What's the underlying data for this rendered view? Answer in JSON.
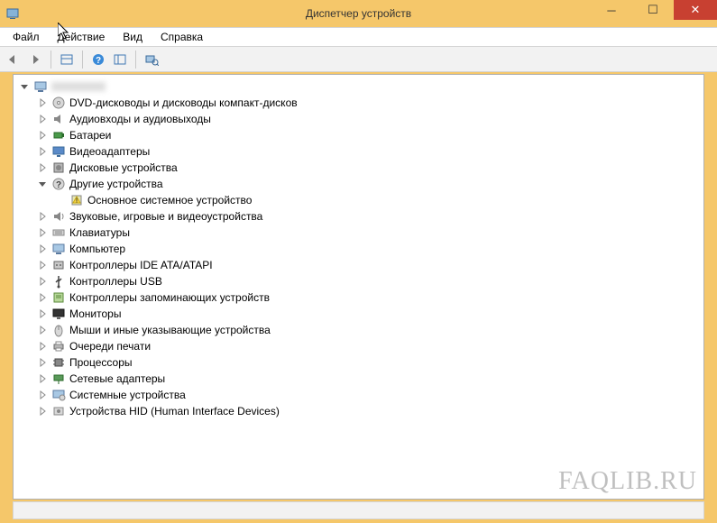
{
  "window": {
    "title": "Диспетчер устройств"
  },
  "menu": {
    "file": "Файл",
    "action": "Действие",
    "view": "Вид",
    "help": "Справка"
  },
  "tree": {
    "root": "",
    "items": [
      {
        "label": "DVD-дисководы и дисководы компакт-дисков",
        "icon": "dvd"
      },
      {
        "label": "Аудиовходы и аудиовыходы",
        "icon": "audio"
      },
      {
        "label": "Батареи",
        "icon": "battery"
      },
      {
        "label": "Видеоадаптеры",
        "icon": "display"
      },
      {
        "label": "Дисковые устройства",
        "icon": "disk"
      },
      {
        "label": "Другие устройства",
        "icon": "other",
        "expanded": true,
        "children": [
          {
            "label": "Основное системное устройство",
            "icon": "warn"
          }
        ]
      },
      {
        "label": "Звуковые, игровые и видеоустройства",
        "icon": "sound"
      },
      {
        "label": "Клавиатуры",
        "icon": "keyboard"
      },
      {
        "label": "Компьютер",
        "icon": "computer"
      },
      {
        "label": "Контроллеры IDE ATA/ATAPI",
        "icon": "ide"
      },
      {
        "label": "Контроллеры USB",
        "icon": "usb"
      },
      {
        "label": "Контроллеры запоминающих устройств",
        "icon": "storage"
      },
      {
        "label": "Мониторы",
        "icon": "monitor"
      },
      {
        "label": "Мыши и иные указывающие устройства",
        "icon": "mouse"
      },
      {
        "label": "Очереди печати",
        "icon": "printer"
      },
      {
        "label": "Процессоры",
        "icon": "cpu"
      },
      {
        "label": "Сетевые адаптеры",
        "icon": "network"
      },
      {
        "label": "Системные устройства",
        "icon": "system"
      },
      {
        "label": "Устройства HID (Human Interface Devices)",
        "icon": "hid"
      }
    ]
  },
  "watermark": "FAQLIB.RU"
}
